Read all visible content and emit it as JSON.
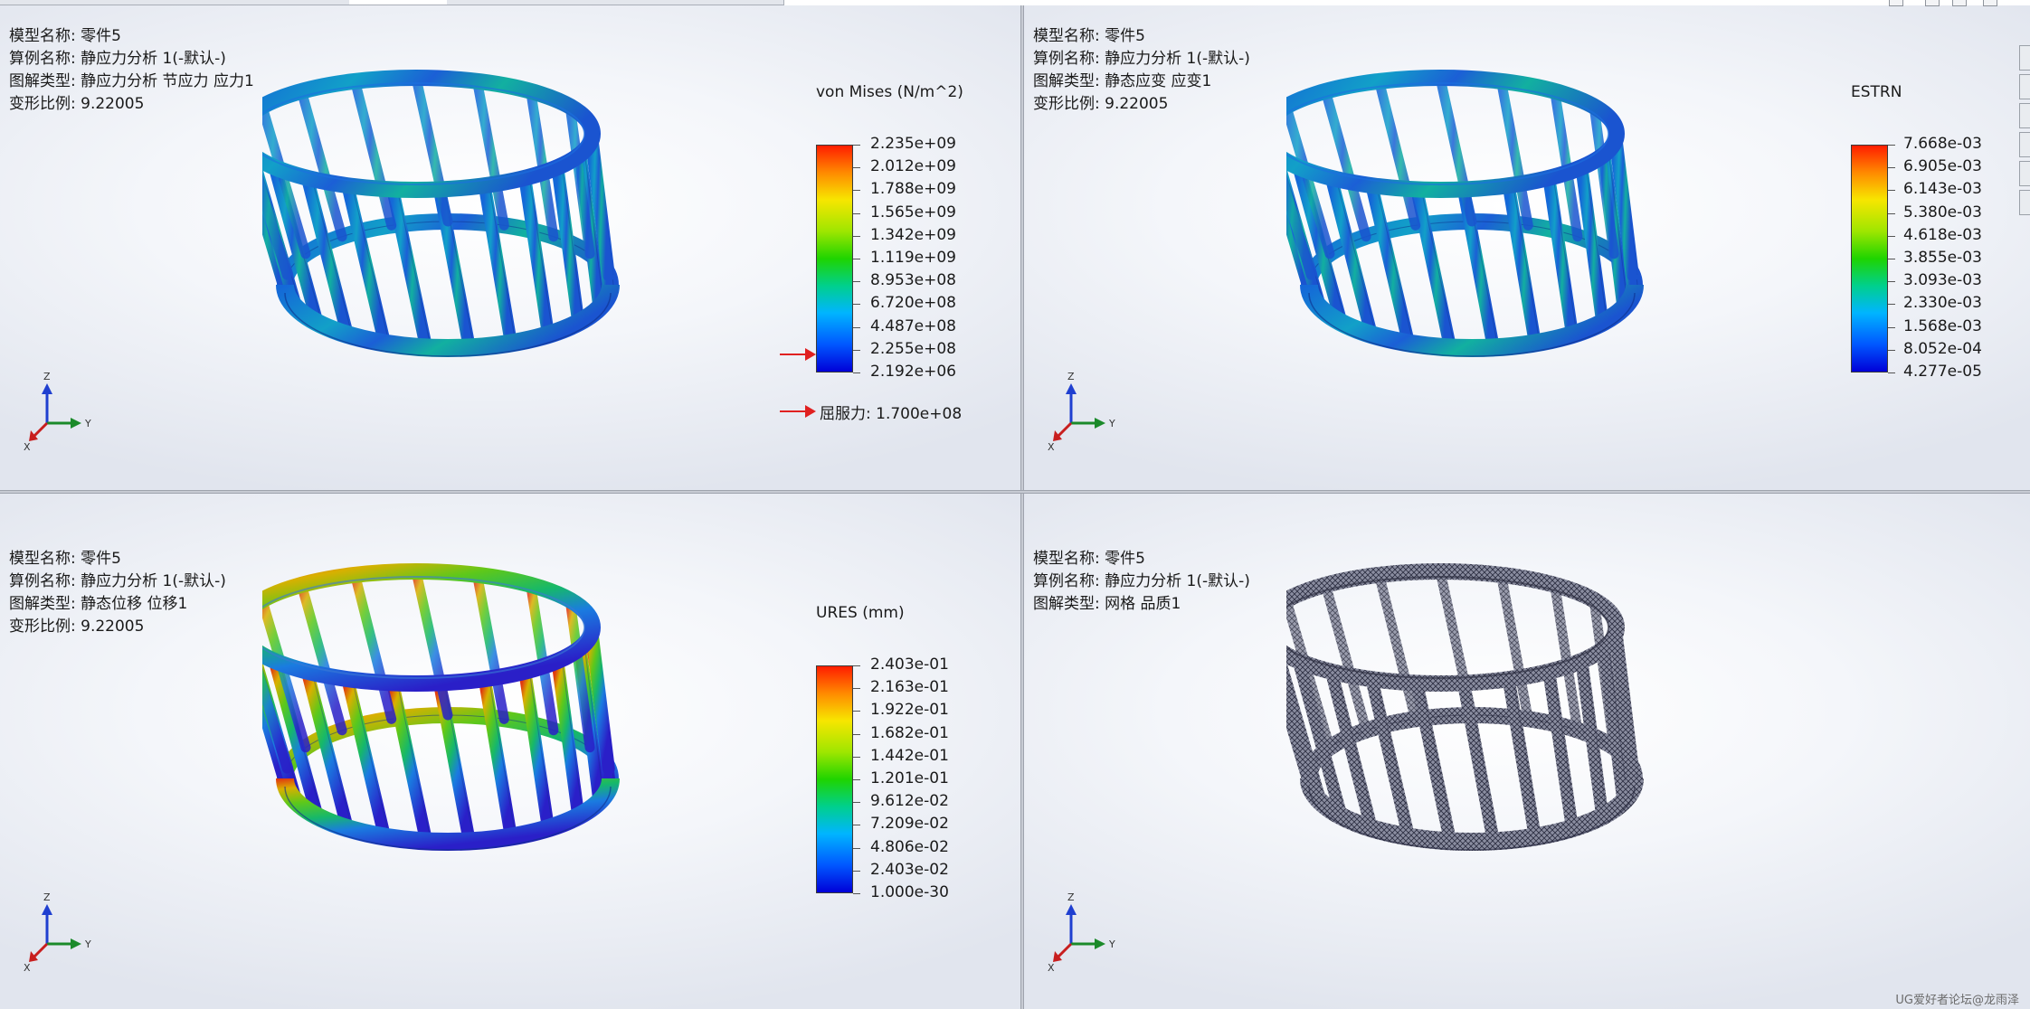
{
  "panels": [
    {
      "info": [
        "模型名称: 零件5",
        "算例名称: 静应力分析 1(-默认-)",
        "图解类型: 静应力分析 节应力 应力1",
        "变形比例: 9.22005"
      ],
      "legend": {
        "title": "von Mises (N/m^2)",
        "ticks": [
          "2.235e+09",
          "2.012e+09",
          "1.788e+09",
          "1.565e+09",
          "1.342e+09",
          "1.119e+09",
          "8.953e+08",
          "6.720e+08",
          "4.487e+08",
          "2.255e+08",
          "2.192e+06"
        ],
        "yield_label": "屈服力: 1.700e+08"
      },
      "model_style": "stress"
    },
    {
      "info": [
        "模型名称: 零件5",
        "算例名称: 静应力分析 1(-默认-)",
        "图解类型: 静态应变 应变1",
        "变形比例: 9.22005"
      ],
      "legend": {
        "title": "ESTRN",
        "ticks": [
          "7.668e-03",
          "6.905e-03",
          "6.143e-03",
          "5.380e-03",
          "4.618e-03",
          "3.855e-03",
          "3.093e-03",
          "2.330e-03",
          "1.568e-03",
          "8.052e-04",
          "4.277e-05"
        ]
      },
      "model_style": "strain"
    },
    {
      "info": [
        "模型名称: 零件5",
        "算例名称: 静应力分析 1(-默认-)",
        "图解类型: 静态位移 位移1",
        "变形比例: 9.22005"
      ],
      "legend": {
        "title": "URES (mm)",
        "ticks": [
          "2.403e-01",
          "2.163e-01",
          "1.922e-01",
          "1.682e-01",
          "1.442e-01",
          "1.201e-01",
          "9.612e-02",
          "7.209e-02",
          "4.806e-02",
          "2.403e-02",
          "1.000e-30"
        ]
      },
      "model_style": "displacement"
    },
    {
      "info": [
        "模型名称: 零件5",
        "算例名称: 静应力分析 1(-默认-)",
        "图解类型: 网格 品质1"
      ],
      "model_style": "mesh"
    }
  ],
  "triad": {
    "x": "X",
    "y": "Y",
    "z": "Z"
  },
  "watermark": "UG爱好者论坛@龙雨泽",
  "colors": {
    "yield_arrow": "#e02020",
    "mesh": "#3d3f55",
    "splitter": "#c7cbd3"
  }
}
